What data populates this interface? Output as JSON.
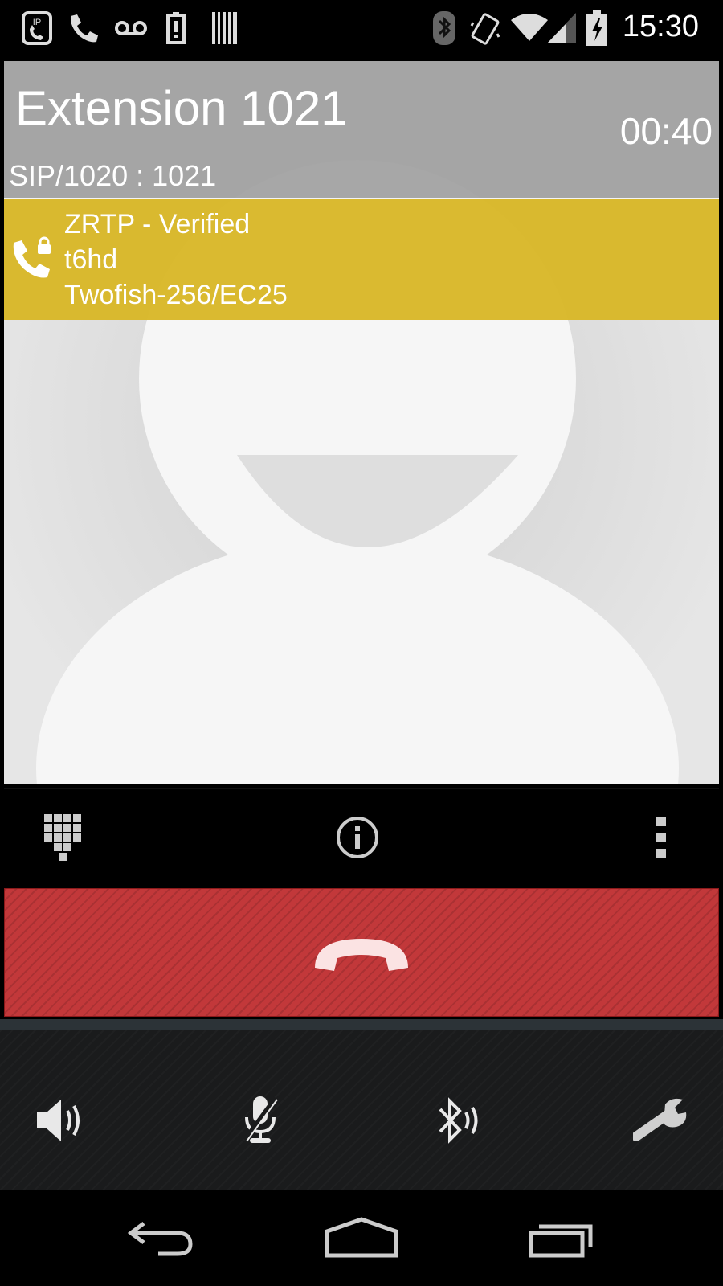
{
  "status_bar": {
    "time": "15:30",
    "icons": [
      "sip-call-icon",
      "phone-icon",
      "voicemail-icon",
      "battery-saver-icon",
      "barcode-icon",
      "bluetooth-icon",
      "vibrate-icon",
      "wifi-icon",
      "signal-icon",
      "battery-charging-icon"
    ]
  },
  "call": {
    "contact_name": "Extension 1021",
    "timer": "00:40",
    "sip_line": "SIP/1020 : 1021"
  },
  "zrtp": {
    "status": "ZRTP - Verified",
    "sas": "t6hd",
    "cipher": "Twofish-256/EC25",
    "accent_color": "#d8b728"
  },
  "toolbar": {
    "icons": [
      "dialpad-icon",
      "info-icon",
      "overflow-menu-icon"
    ]
  },
  "hangup": {
    "icon": "hang-up-icon",
    "color": "#c2383a"
  },
  "audio_controls": {
    "icons": [
      "speaker-icon",
      "mute-microphone-icon",
      "bluetooth-audio-icon",
      "settings-wrench-icon"
    ]
  },
  "nav_bar": {
    "icons": [
      "back-icon",
      "home-icon",
      "recents-icon"
    ]
  }
}
